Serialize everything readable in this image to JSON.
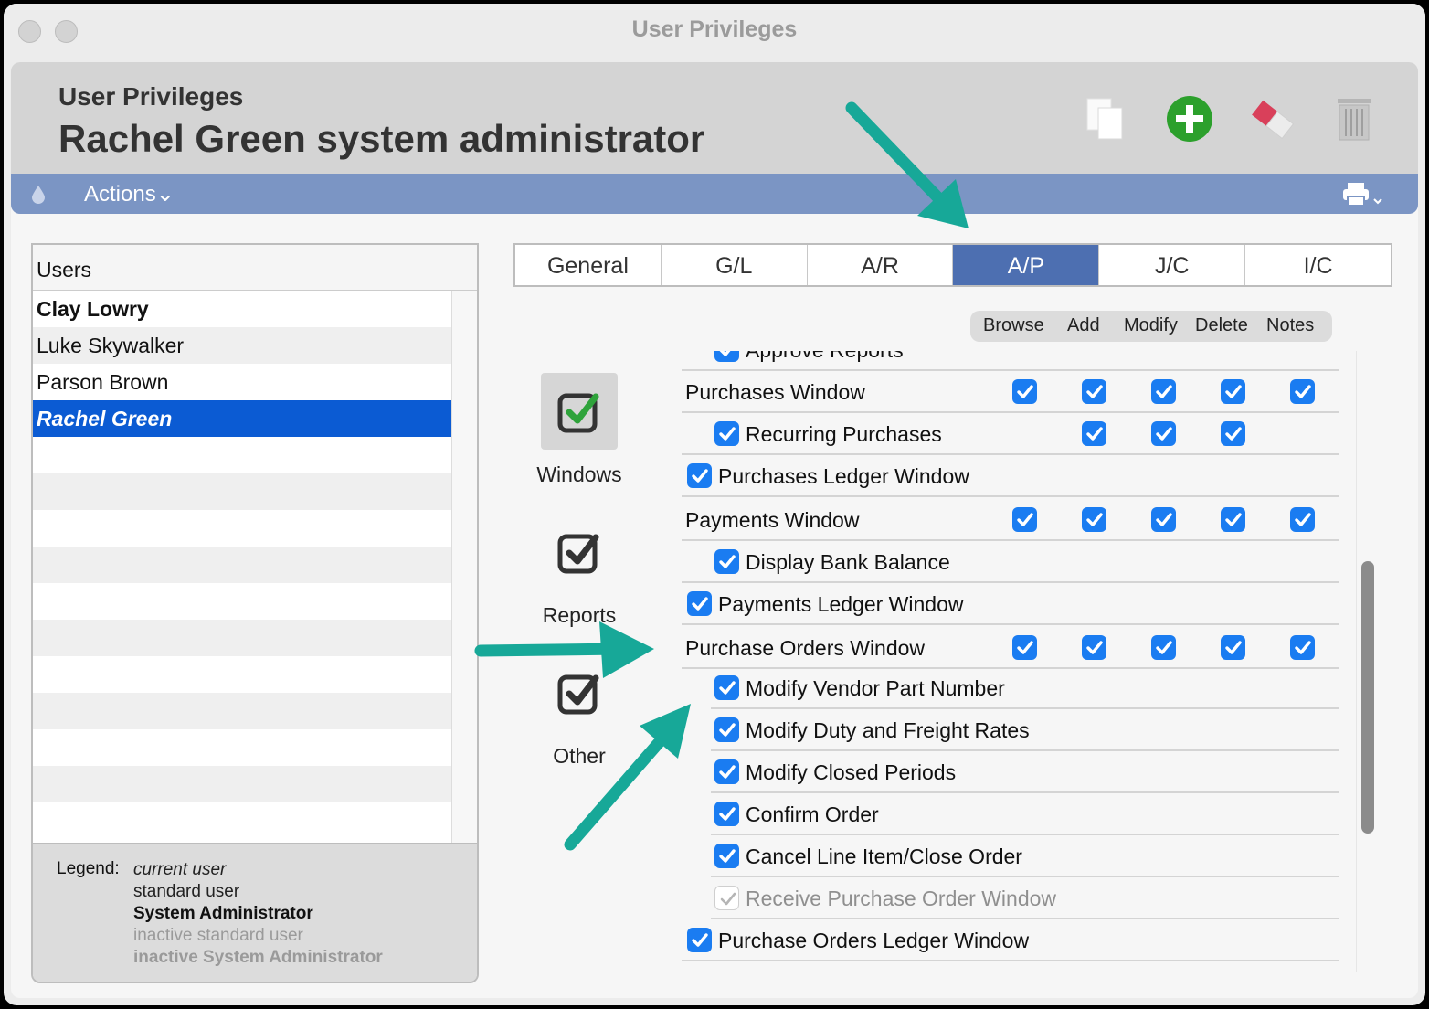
{
  "window": {
    "title": "User Privileges"
  },
  "header": {
    "subtitle": "User Privileges",
    "title": "Rachel Green system administrator"
  },
  "actionbar": {
    "actions_label": "Actions⌄"
  },
  "users": {
    "heading": "Users",
    "rows": [
      {
        "name": "Clay Lowry",
        "style": "bold"
      },
      {
        "name": "Luke Skywalker",
        "style": "normal"
      },
      {
        "name": "Parson Brown",
        "style": "normal"
      },
      {
        "name": "Rachel Green",
        "style": "selected"
      }
    ]
  },
  "legend": {
    "label": "Legend:",
    "current": "current user",
    "standard": "standard user",
    "admin": "System Administrator",
    "inactive": "inactive standard user",
    "inactive_admin": "inactive System Administrator"
  },
  "tabs": [
    "General",
    "G/L",
    "A/R",
    "A/P",
    "J/C",
    "I/C"
  ],
  "active_tab": "A/P",
  "columns": [
    "Browse",
    "Add",
    "Modify",
    "Delete",
    "Notes"
  ],
  "categories": {
    "windows": "Windows",
    "reports": "Reports",
    "other": "Other"
  },
  "privileges": [
    {
      "label": "Approve Reports"
    },
    {
      "label": "Purchases Window"
    },
    {
      "label": "Recurring Purchases"
    },
    {
      "label": "Purchases Ledger Window"
    },
    {
      "label": "Payments Window"
    },
    {
      "label": "Display Bank Balance"
    },
    {
      "label": "Payments Ledger Window"
    },
    {
      "label": "Purchase Orders Window"
    },
    {
      "label": "Modify Vendor Part Number"
    },
    {
      "label": "Modify Duty and Freight Rates"
    },
    {
      "label": "Modify Closed Periods"
    },
    {
      "label": "Confirm Order"
    },
    {
      "label": "Cancel Line Item/Close Order"
    },
    {
      "label": "Receive Purchase Order Window"
    },
    {
      "label": "Purchase Orders Ledger Window"
    }
  ],
  "colors": {
    "accent": "#1a7cf1",
    "selection": "#0b5bd3",
    "tab_active": "#4d6fb1",
    "bar": "#7b95c4",
    "arrow": "#17a898"
  }
}
